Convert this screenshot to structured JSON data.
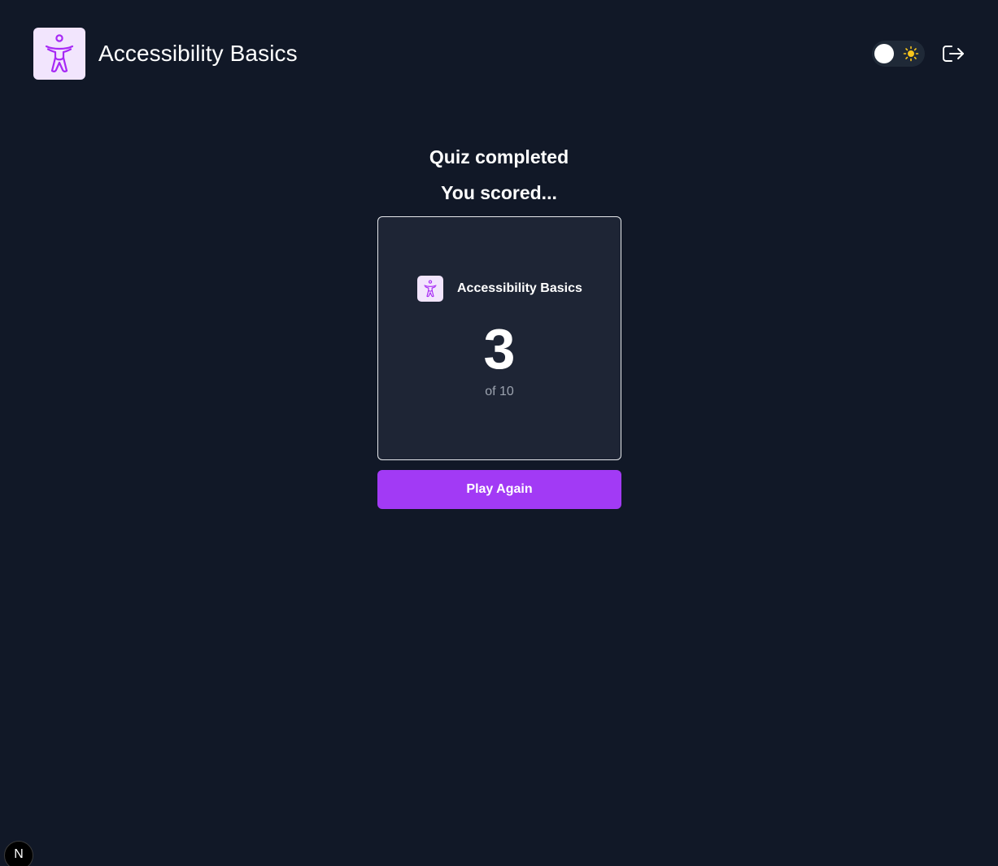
{
  "header": {
    "title": "Accessibility Basics",
    "logo_icon": "accessibility-icon",
    "theme_toggle": {
      "state": "dark",
      "icon": "sun-icon"
    },
    "logout_icon": "logout-icon"
  },
  "result": {
    "heading": "Quiz completed",
    "subheading": "You scored...",
    "card": {
      "topic_icon": "accessibility-icon",
      "topic": "Accessibility Basics",
      "score": "3",
      "total": "of 10"
    },
    "play_again_label": "Play Again"
  },
  "dev_badge": {
    "label": "N"
  },
  "colors": {
    "background": "#111827",
    "card": "#1e2535",
    "accent": "#a23af5",
    "icon_tile": "#f2e5fd",
    "icon_stroke": "#a729f5",
    "sun": "#f8c51c"
  }
}
